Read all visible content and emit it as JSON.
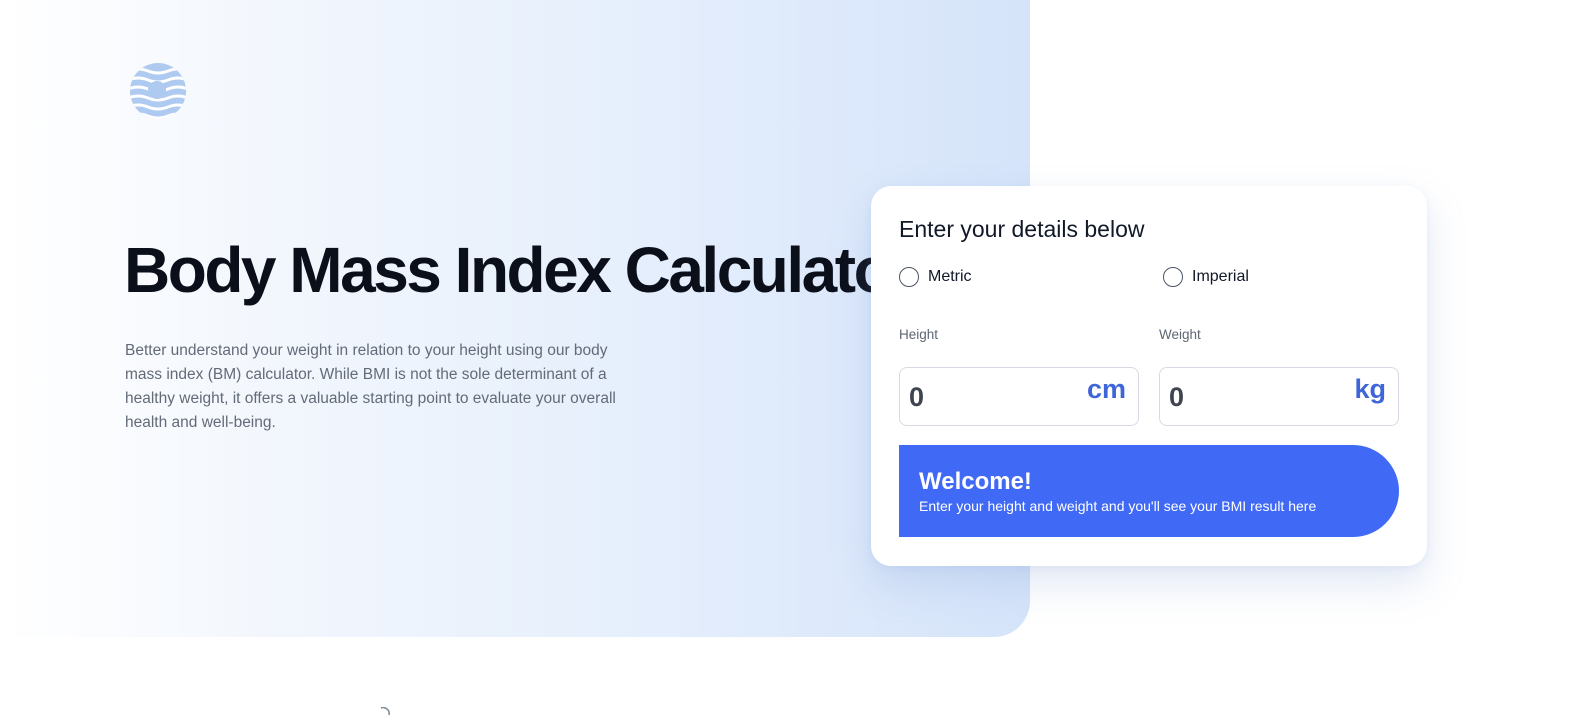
{
  "hero": {
    "logo_icon": "logo-icon",
    "title": "Body Mass Index Calculator",
    "description": "Better understand your weight in relation to your height using our body mass index (BM) calculator. While BMI is not the sole determinant of a healthy weight, it offers a valuable starting point to evaluate your overall health and well-being."
  },
  "form": {
    "title": "Enter your details below",
    "units": {
      "metric_label": "Metric",
      "imperial_label": "Imperial"
    },
    "height": {
      "label": "Height",
      "value": "0",
      "unit": "cm"
    },
    "weight": {
      "label": "Weight",
      "value": "0",
      "unit": "kg"
    },
    "result": {
      "title": "Welcome!",
      "text": "Enter your height and weight and you'll see your BMI result here"
    }
  },
  "colors": {
    "accent": "#4069F6",
    "unit_text": "#3F66D8",
    "hero_gradient_end": "#D5E4FA"
  }
}
